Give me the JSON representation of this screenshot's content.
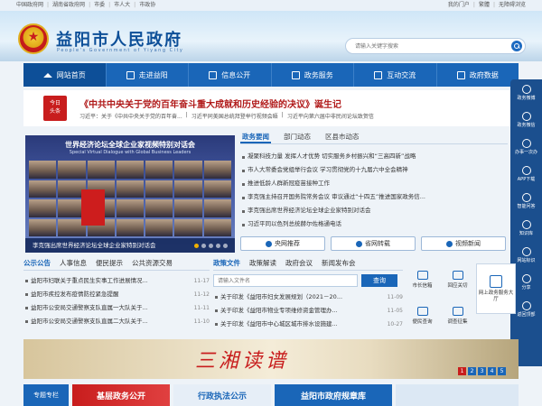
{
  "topbar": {
    "links": [
      "中国政府网",
      "湖南省政府网",
      "市委",
      "市人大",
      "市政协"
    ],
    "right": [
      "我的门户",
      "繁體",
      "无障碍浏览"
    ]
  },
  "header": {
    "title": "益阳市人民政府",
    "subtitle": "People's Government of Yiyang City",
    "search_placeholder": "请输入关键字搜索"
  },
  "nav": {
    "items": [
      "网站首页",
      "走进益阳",
      "信息公开",
      "政务服务",
      "互动交流",
      "政府数据"
    ]
  },
  "headline": {
    "badge_line1": "今日",
    "badge_line2": "头条",
    "title": "《中共中央关于党的百年奋斗重大成就和历史经验的决议》诞生记",
    "sub": [
      "习近平：关于《中共中央关于党的百年奋...",
      "习近平同美国总统拜登举行视频会晤",
      "习近平向第六届中非民间论坛致贺信"
    ]
  },
  "slider": {
    "title": "世界经济论坛全球企业家视频特别对话会",
    "subtitle": "Special Virtual Dialogue with Global Business Leaders",
    "caption": "李克强出席世界经济论坛全球企业家特别对话会"
  },
  "news": {
    "tabs": [
      "政务要闻",
      "部门动态",
      "区县市动态"
    ],
    "items": [
      "凝聚科技力量 发挥人才优势 切实服务乡村振兴和“三高四新”战略",
      "市人大常委会党组举行会议 学习贯彻党的十九届六中全会精神",
      "推进低龄人群新冠疫苗接种工作",
      "李克强主持召开国务院常务会议 审议通过“十四五”推进国家政务信...",
      "李克强出席世界经济论坛全球企业家特别对话会",
      "习近平同以色列总统赫尔佐格通电话"
    ],
    "buttons": [
      "央网推荐",
      "省网转载",
      "视频新闻"
    ]
  },
  "float": {
    "items": [
      "政务微博",
      "政务微信",
      "办事一次办",
      "APP下载",
      "智能问答",
      "知识库",
      "网站标识",
      "分享"
    ],
    "top": "返回顶部"
  },
  "notices": {
    "tabs": [
      "公示公告",
      "人事信息",
      "便民提示",
      "公共资源交易"
    ],
    "items": [
      {
        "t": "益阳市妇联关于重点民生实事工作进展情况...",
        "d": "11-17"
      },
      {
        "t": "益阳市疾控发布疫情防控紧急提醒",
        "d": "11-12"
      },
      {
        "t": "益阳市公安局交通警察支队直属一大队关于...",
        "d": "11-11"
      },
      {
        "t": "益阳市公安局交通警察支队直属二大队关于...",
        "d": "11-10"
      }
    ]
  },
  "docs": {
    "tabs": [
      "政策文件",
      "政策解读",
      "政府会议",
      "新闻发布会"
    ],
    "search_placeholder": "请输入文件名",
    "search_button": "查询",
    "items": [
      {
        "t": "关于印发《益阳市妇女发展规划（2021－20...",
        "d": "11-09"
      },
      {
        "t": "关于印发《益阳市物业专项维修资金管理办...",
        "d": "11-05"
      },
      {
        "t": "关于印发《益阳市中心城区城市排水设施建...",
        "d": "10-27"
      }
    ]
  },
  "services": {
    "items": [
      "市长信箱",
      "回应关切",
      "便民查询",
      "调查征集"
    ],
    "box": "网上政务服务大厅"
  },
  "banner": {
    "text": "三湘读谱",
    "pages": [
      "1",
      "2",
      "3",
      "4",
      "5"
    ]
  },
  "bottom": {
    "b1": "专题专栏",
    "b2": "基层政务公开",
    "b3": "行政执法公示",
    "b4": "益阳市政府规章库"
  }
}
